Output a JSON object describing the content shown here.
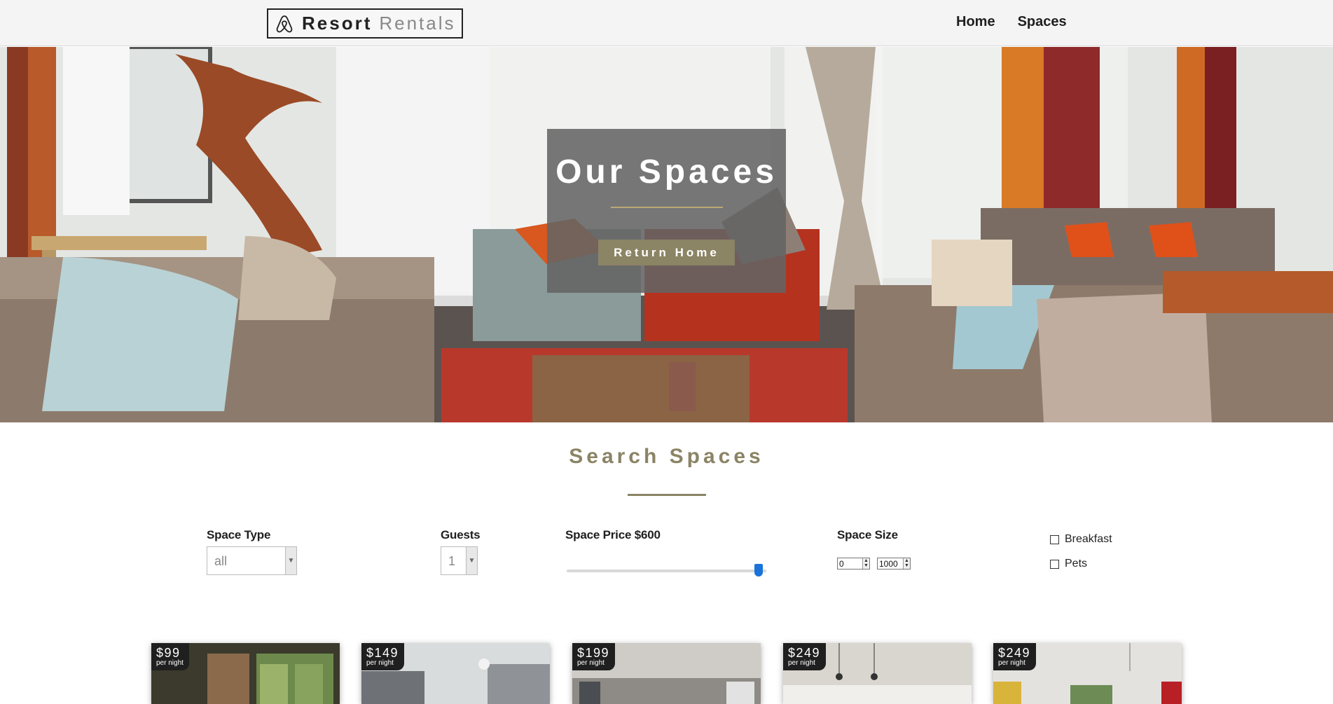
{
  "brand": {
    "name_main": "Resort",
    "name_accent": "Rentals",
    "icon": "airbnb-logo-icon"
  },
  "nav": [
    {
      "label": "Home"
    },
    {
      "label": "Spaces"
    }
  ],
  "hero": {
    "title": "Our Spaces",
    "button_label": "Return Home"
  },
  "search": {
    "title": "Search Spaces",
    "space_type": {
      "label": "Space Type",
      "value": "all"
    },
    "guests": {
      "label": "Guests",
      "value": "1"
    },
    "price": {
      "label": "Space Price $600",
      "slider_fraction": 0.96
    },
    "size": {
      "label": "Space Size",
      "min": "0",
      "max": "1000"
    },
    "amenities": [
      {
        "label": "Breakfast"
      },
      {
        "label": "Pets"
      }
    ]
  },
  "cards": [
    {
      "price": "$99",
      "unit": "per night"
    },
    {
      "price": "$149",
      "unit": "per night"
    },
    {
      "price": "$199",
      "unit": "per night"
    },
    {
      "price": "$249",
      "unit": "per night"
    },
    {
      "price": "$249",
      "unit": "per night"
    }
  ],
  "colors": {
    "accent": "#8b8465",
    "slider": "#1a73d9",
    "badge": "#1f1f1f"
  }
}
